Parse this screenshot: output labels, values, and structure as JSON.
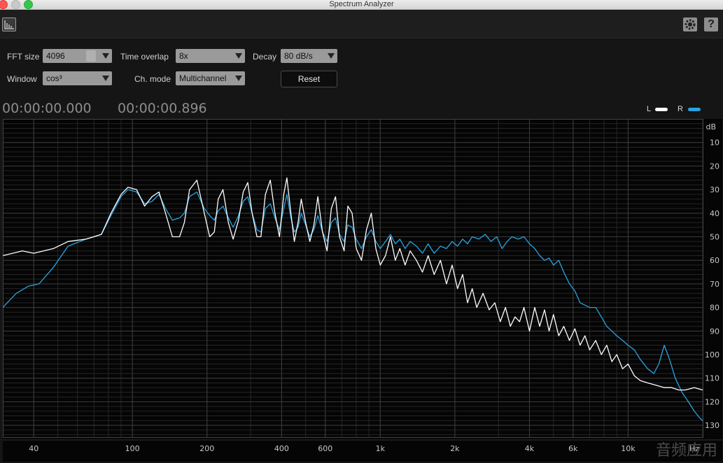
{
  "window": {
    "title": "Spectrum Analyzer"
  },
  "toolbar": {
    "left_icon": "spectrum-view-icon",
    "settings_icon": "gear-icon",
    "help_icon": "help-icon",
    "help_glyph": "?"
  },
  "controls": {
    "fft_size_label": "FFT size",
    "fft_size_value": "4096",
    "time_overlap_label": "Time overlap",
    "time_overlap_value": "8x",
    "decay_label": "Decay",
    "decay_value": "80 dB/s",
    "window_label": "Window",
    "window_value": "cos³",
    "ch_mode_label": "Ch. mode",
    "ch_mode_value": "Multichannel",
    "reset_label": "Reset"
  },
  "time": {
    "start": "00:00:00.000",
    "end": "00:00:00.896"
  },
  "legend": [
    {
      "name": "L",
      "color": "#ffffff"
    },
    {
      "name": "R",
      "color": "#29a3e0"
    }
  ],
  "watermark": "音频应用",
  "chart_data": {
    "type": "line",
    "xscale": "log",
    "xlim": [
      30,
      20000
    ],
    "xlabel": "Hz",
    "ylabel": "dB",
    "ylim": [
      0,
      135
    ],
    "y_inverted": true,
    "x_ticks": [
      {
        "v": 40,
        "label": "40"
      },
      {
        "v": 100,
        "label": "100"
      },
      {
        "v": 200,
        "label": "200"
      },
      {
        "v": 400,
        "label": "400"
      },
      {
        "v": 600,
        "label": "600"
      },
      {
        "v": 1000,
        "label": "1k"
      },
      {
        "v": 2000,
        "label": "2k"
      },
      {
        "v": 4000,
        "label": "4k"
      },
      {
        "v": 6000,
        "label": "6k"
      },
      {
        "v": 10000,
        "label": "10k"
      }
    ],
    "y_ticks": [
      10,
      20,
      30,
      40,
      50,
      60,
      70,
      80,
      90,
      100,
      110,
      120,
      130
    ],
    "grid": true,
    "series": [
      {
        "name": "L",
        "color": "#ffffff",
        "points": [
          [
            30,
            58
          ],
          [
            36,
            56
          ],
          [
            40,
            57
          ],
          [
            48,
            55
          ],
          [
            55,
            52
          ],
          [
            65,
            51
          ],
          [
            75,
            49
          ],
          [
            82,
            40
          ],
          [
            90,
            32
          ],
          [
            96,
            29
          ],
          [
            104,
            30
          ],
          [
            112,
            37
          ],
          [
            120,
            33
          ],
          [
            128,
            31
          ],
          [
            136,
            40
          ],
          [
            145,
            50
          ],
          [
            155,
            50
          ],
          [
            162,
            44
          ],
          [
            170,
            30
          ],
          [
            182,
            26
          ],
          [
            195,
            40
          ],
          [
            205,
            50
          ],
          [
            214,
            48
          ],
          [
            222,
            34
          ],
          [
            232,
            30
          ],
          [
            244,
            44
          ],
          [
            255,
            51
          ],
          [
            268,
            43
          ],
          [
            280,
            31
          ],
          [
            292,
            27
          ],
          [
            304,
            40
          ],
          [
            318,
            50
          ],
          [
            330,
            50
          ],
          [
            344,
            32
          ],
          [
            360,
            26
          ],
          [
            376,
            40
          ],
          [
            392,
            50
          ],
          [
            408,
            32
          ],
          [
            420,
            25
          ],
          [
            436,
            40
          ],
          [
            450,
            52
          ],
          [
            466,
            44
          ],
          [
            480,
            34
          ],
          [
            500,
            44
          ],
          [
            520,
            52
          ],
          [
            540,
            45
          ],
          [
            560,
            33
          ],
          [
            585,
            48
          ],
          [
            610,
            56
          ],
          [
            635,
            38
          ],
          [
            660,
            33
          ],
          [
            685,
            50
          ],
          [
            715,
            56
          ],
          [
            740,
            37
          ],
          [
            770,
            40
          ],
          [
            800,
            55
          ],
          [
            840,
            60
          ],
          [
            880,
            47
          ],
          [
            920,
            40
          ],
          [
            960,
            55
          ],
          [
            1000,
            62
          ],
          [
            1050,
            58
          ],
          [
            1100,
            50
          ],
          [
            1150,
            60
          ],
          [
            1200,
            55
          ],
          [
            1260,
            62
          ],
          [
            1320,
            56
          ],
          [
            1400,
            60
          ],
          [
            1480,
            65
          ],
          [
            1560,
            58
          ],
          [
            1650,
            66
          ],
          [
            1750,
            60
          ],
          [
            1850,
            70
          ],
          [
            1950,
            62
          ],
          [
            2050,
            72
          ],
          [
            2150,
            66
          ],
          [
            2250,
            78
          ],
          [
            2350,
            72
          ],
          [
            2450,
            80
          ],
          [
            2600,
            74
          ],
          [
            2750,
            81
          ],
          [
            2900,
            78
          ],
          [
            3050,
            86
          ],
          [
            3200,
            80
          ],
          [
            3350,
            88
          ],
          [
            3500,
            84
          ],
          [
            3650,
            86
          ],
          [
            3800,
            80
          ],
          [
            4000,
            90
          ],
          [
            4200,
            80
          ],
          [
            4400,
            88
          ],
          [
            4600,
            81
          ],
          [
            4800,
            90
          ],
          [
            5000,
            83
          ],
          [
            5250,
            92
          ],
          [
            5500,
            88
          ],
          [
            5800,
            94
          ],
          [
            6100,
            89
          ],
          [
            6400,
            96
          ],
          [
            6700,
            92
          ],
          [
            7000,
            98
          ],
          [
            7400,
            94
          ],
          [
            7800,
            100
          ],
          [
            8200,
            96
          ],
          [
            8600,
            103
          ],
          [
            9000,
            100
          ],
          [
            9500,
            106
          ],
          [
            10000,
            104
          ],
          [
            10600,
            109
          ],
          [
            11200,
            111
          ],
          [
            12000,
            112
          ],
          [
            13000,
            113
          ],
          [
            14000,
            114
          ],
          [
            15000,
            114
          ],
          [
            16000,
            115
          ],
          [
            17000,
            115
          ],
          [
            18500,
            114
          ],
          [
            20000,
            115
          ]
        ]
      },
      {
        "name": "R",
        "color": "#29a3e0",
        "points": [
          [
            30,
            80
          ],
          [
            34,
            74
          ],
          [
            38,
            71
          ],
          [
            42,
            70
          ],
          [
            48,
            63
          ],
          [
            55,
            54
          ],
          [
            65,
            51
          ],
          [
            75,
            49
          ],
          [
            82,
            41
          ],
          [
            90,
            33
          ],
          [
            96,
            30
          ],
          [
            104,
            31
          ],
          [
            112,
            36
          ],
          [
            120,
            35
          ],
          [
            128,
            32
          ],
          [
            136,
            38
          ],
          [
            145,
            43
          ],
          [
            155,
            42
          ],
          [
            162,
            40
          ],
          [
            170,
            33
          ],
          [
            182,
            31
          ],
          [
            195,
            38
          ],
          [
            205,
            41
          ],
          [
            214,
            43
          ],
          [
            222,
            39
          ],
          [
            232,
            37
          ],
          [
            244,
            42
          ],
          [
            255,
            46
          ],
          [
            268,
            41
          ],
          [
            280,
            35
          ],
          [
            292,
            33
          ],
          [
            304,
            40
          ],
          [
            318,
            47
          ],
          [
            330,
            48
          ],
          [
            344,
            38
          ],
          [
            360,
            36
          ],
          [
            376,
            42
          ],
          [
            392,
            47
          ],
          [
            408,
            38
          ],
          [
            420,
            32
          ],
          [
            436,
            42
          ],
          [
            450,
            48
          ],
          [
            466,
            46
          ],
          [
            480,
            40
          ],
          [
            500,
            45
          ],
          [
            520,
            50
          ],
          [
            540,
            47
          ],
          [
            560,
            41
          ],
          [
            585,
            48
          ],
          [
            610,
            52
          ],
          [
            635,
            44
          ],
          [
            660,
            42
          ],
          [
            685,
            49
          ],
          [
            715,
            52
          ],
          [
            740,
            45
          ],
          [
            770,
            46
          ],
          [
            800,
            51
          ],
          [
            840,
            55
          ],
          [
            880,
            50
          ],
          [
            920,
            47
          ],
          [
            960,
            52
          ],
          [
            1000,
            55
          ],
          [
            1050,
            52
          ],
          [
            1100,
            49
          ],
          [
            1150,
            53
          ],
          [
            1200,
            51
          ],
          [
            1260,
            55
          ],
          [
            1320,
            52
          ],
          [
            1400,
            54
          ],
          [
            1480,
            57
          ],
          [
            1560,
            53
          ],
          [
            1650,
            57
          ],
          [
            1750,
            54
          ],
          [
            1850,
            55
          ],
          [
            1950,
            52
          ],
          [
            2050,
            54
          ],
          [
            2150,
            51
          ],
          [
            2250,
            53
          ],
          [
            2350,
            50
          ],
          [
            2500,
            51
          ],
          [
            2650,
            49
          ],
          [
            2800,
            52
          ],
          [
            2950,
            50
          ],
          [
            3100,
            55
          ],
          [
            3250,
            52
          ],
          [
            3400,
            50
          ],
          [
            3600,
            51
          ],
          [
            3800,
            50
          ],
          [
            4000,
            53
          ],
          [
            4200,
            55
          ],
          [
            4400,
            58
          ],
          [
            4600,
            60
          ],
          [
            4800,
            59
          ],
          [
            5000,
            62
          ],
          [
            5250,
            60
          ],
          [
            5500,
            65
          ],
          [
            5800,
            70
          ],
          [
            6100,
            73
          ],
          [
            6400,
            78
          ],
          [
            6700,
            79
          ],
          [
            7000,
            80
          ],
          [
            7400,
            80
          ],
          [
            7800,
            84
          ],
          [
            8200,
            88
          ],
          [
            8600,
            90
          ],
          [
            9000,
            92
          ],
          [
            9500,
            94
          ],
          [
            10000,
            96
          ],
          [
            10600,
            98
          ],
          [
            11200,
            102
          ],
          [
            12000,
            106
          ],
          [
            12700,
            108
          ],
          [
            13300,
            104
          ],
          [
            14000,
            96
          ],
          [
            14700,
            102
          ],
          [
            15500,
            110
          ],
          [
            16500,
            116
          ],
          [
            17500,
            120
          ],
          [
            18500,
            124
          ],
          [
            19500,
            127
          ],
          [
            20000,
            128
          ]
        ]
      }
    ]
  }
}
